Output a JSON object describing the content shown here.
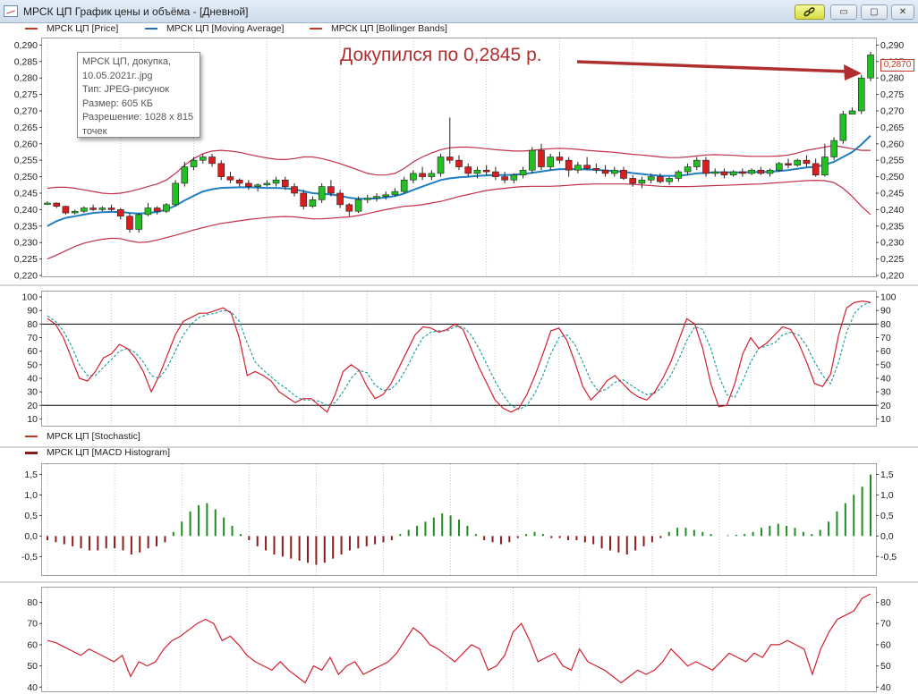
{
  "window": {
    "title": "МРСК ЦП График цены и объёма - [Дневной]",
    "buttons": {
      "min": "▭",
      "max": "▢",
      "close": "✕"
    }
  },
  "legend_main": [
    {
      "label": "МРСК ЦП [Price]",
      "color": "#c0392b"
    },
    {
      "label": "МРСК ЦП [Moving Average]",
      "color": "#1f6fb4"
    },
    {
      "label": "МРСК ЦП [Bollinger Bands]",
      "color": "#c0392b"
    }
  ],
  "legend_lower": [
    {
      "label": "МРСК ЦП [Stochastic]",
      "color": "#c0392b"
    },
    {
      "label": "МРСК ЦП [MACD Histogram]",
      "color": "#8b1a1a"
    }
  ],
  "tooltip": {
    "lines": [
      "МРСК ЦП, докупка,",
      "10.05.2021г..jpg",
      "Тип: JPEG-рисунок",
      "Размер: 605 КБ",
      "Разрешение: 1028 x 815",
      "точек"
    ]
  },
  "annotation": {
    "text": "Докупился по 0,2845 р.",
    "color": "#b03030"
  },
  "last_price_label": "0,2870",
  "colors": {
    "up": "#22c022",
    "down": "#d81e1e",
    "ma": "#1f7fc0",
    "bands": "#c0304a",
    "stoch": "#d02030",
    "signal": "#2aa0a0",
    "macd_pos": "#1e8c1e",
    "macd_neg": "#8b1a1a",
    "grid": "#c8c8c8"
  },
  "chart_data": [
    {
      "type": "candlestick",
      "name": "price",
      "ylim": [
        0.22,
        0.292
      ],
      "yticks": [
        "0,220",
        "0,225",
        "0,230",
        "0,235",
        "0,240",
        "0,245",
        "0,250",
        "0,255",
        "0,260",
        "0,265",
        "0,270",
        "0,275",
        "0,280",
        "0,285",
        "0,290"
      ],
      "candles": [
        [
          0.242,
          0.2425,
          0.2415,
          0.242
        ],
        [
          0.242,
          0.2422,
          0.2405,
          0.241
        ],
        [
          0.241,
          0.2412,
          0.2385,
          0.239
        ],
        [
          0.239,
          0.24,
          0.2385,
          0.2395
        ],
        [
          0.2395,
          0.241,
          0.239,
          0.2405
        ],
        [
          0.2405,
          0.2415,
          0.2395,
          0.24
        ],
        [
          0.24,
          0.241,
          0.2395,
          0.2405
        ],
        [
          0.2405,
          0.2415,
          0.2395,
          0.24
        ],
        [
          0.24,
          0.2405,
          0.237,
          0.238
        ],
        [
          0.238,
          0.239,
          0.233,
          0.234
        ],
        [
          0.234,
          0.239,
          0.233,
          0.2385
        ],
        [
          0.2385,
          0.242,
          0.238,
          0.2405
        ],
        [
          0.2405,
          0.241,
          0.2385,
          0.2395
        ],
        [
          0.2395,
          0.242,
          0.239,
          0.2415
        ],
        [
          0.2415,
          0.249,
          0.241,
          0.248
        ],
        [
          0.248,
          0.2545,
          0.247,
          0.253
        ],
        [
          0.253,
          0.256,
          0.252,
          0.255
        ],
        [
          0.255,
          0.257,
          0.254,
          0.256
        ],
        [
          0.256,
          0.257,
          0.253,
          0.254
        ],
        [
          0.254,
          0.255,
          0.249,
          0.25
        ],
        [
          0.25,
          0.2515,
          0.248,
          0.249
        ],
        [
          0.249,
          0.2495,
          0.247,
          0.248
        ],
        [
          0.248,
          0.249,
          0.246,
          0.247
        ],
        [
          0.247,
          0.248,
          0.2455,
          0.2475
        ],
        [
          0.2475,
          0.249,
          0.247,
          0.248
        ],
        [
          0.248,
          0.25,
          0.247,
          0.249
        ],
        [
          0.249,
          0.25,
          0.246,
          0.247
        ],
        [
          0.247,
          0.248,
          0.244,
          0.245
        ],
        [
          0.245,
          0.246,
          0.24,
          0.241
        ],
        [
          0.241,
          0.244,
          0.2405,
          0.243
        ],
        [
          0.243,
          0.248,
          0.242,
          0.247
        ],
        [
          0.247,
          0.249,
          0.244,
          0.245
        ],
        [
          0.245,
          0.246,
          0.2405,
          0.2415
        ],
        [
          0.2415,
          0.242,
          0.238,
          0.2395
        ],
        [
          0.2395,
          0.244,
          0.239,
          0.243
        ],
        [
          0.243,
          0.2445,
          0.242,
          0.2435
        ],
        [
          0.2435,
          0.245,
          0.2425,
          0.244
        ],
        [
          0.244,
          0.2455,
          0.243,
          0.2445
        ],
        [
          0.2445,
          0.2465,
          0.244,
          0.2455
        ],
        [
          0.2455,
          0.25,
          0.245,
          0.249
        ],
        [
          0.249,
          0.252,
          0.248,
          0.251
        ],
        [
          0.251,
          0.253,
          0.249,
          0.25
        ],
        [
          0.25,
          0.252,
          0.249,
          0.251
        ],
        [
          0.251,
          0.257,
          0.25,
          0.256
        ],
        [
          0.256,
          0.268,
          0.254,
          0.255
        ],
        [
          0.255,
          0.2565,
          0.252,
          0.253
        ],
        [
          0.253,
          0.254,
          0.25,
          0.251
        ],
        [
          0.251,
          0.253,
          0.2495,
          0.252
        ],
        [
          0.252,
          0.2535,
          0.2505,
          0.2515
        ],
        [
          0.2515,
          0.253,
          0.249,
          0.25
        ],
        [
          0.25,
          0.2515,
          0.248,
          0.249
        ],
        [
          0.249,
          0.251,
          0.248,
          0.2505
        ],
        [
          0.2505,
          0.253,
          0.2495,
          0.252
        ],
        [
          0.252,
          0.259,
          0.251,
          0.258
        ],
        [
          0.258,
          0.26,
          0.252,
          0.253
        ],
        [
          0.253,
          0.257,
          0.252,
          0.256
        ],
        [
          0.256,
          0.2575,
          0.254,
          0.255
        ],
        [
          0.255,
          0.256,
          0.25,
          0.252
        ],
        [
          0.252,
          0.2545,
          0.251,
          0.2535
        ],
        [
          0.2535,
          0.256,
          0.252,
          0.2525
        ],
        [
          0.2525,
          0.254,
          0.251,
          0.252
        ],
        [
          0.252,
          0.2535,
          0.25,
          0.251
        ],
        [
          0.251,
          0.253,
          0.25,
          0.252
        ],
        [
          0.252,
          0.253,
          0.249,
          0.2495
        ],
        [
          0.2495,
          0.2505,
          0.247,
          0.248
        ],
        [
          0.248,
          0.25,
          0.2465,
          0.249
        ],
        [
          0.249,
          0.251,
          0.248,
          0.25
        ],
        [
          0.25,
          0.251,
          0.248,
          0.2485
        ],
        [
          0.2485,
          0.25,
          0.2475,
          0.2495
        ],
        [
          0.2495,
          0.252,
          0.2485,
          0.2515
        ],
        [
          0.2515,
          0.254,
          0.2505,
          0.253
        ],
        [
          0.253,
          0.256,
          0.252,
          0.255
        ],
        [
          0.255,
          0.256,
          0.25,
          0.251
        ],
        [
          0.251,
          0.2525,
          0.25,
          0.2515
        ],
        [
          0.2515,
          0.2525,
          0.2495,
          0.2505
        ],
        [
          0.2505,
          0.252,
          0.25,
          0.2515
        ],
        [
          0.2515,
          0.2525,
          0.25,
          0.251
        ],
        [
          0.251,
          0.2525,
          0.2505,
          0.252
        ],
        [
          0.252,
          0.253,
          0.2505,
          0.251
        ],
        [
          0.251,
          0.2525,
          0.25,
          0.252
        ],
        [
          0.252,
          0.2545,
          0.2515,
          0.254
        ],
        [
          0.254,
          0.2555,
          0.2525,
          0.2535
        ],
        [
          0.2535,
          0.2555,
          0.253,
          0.255
        ],
        [
          0.255,
          0.2565,
          0.253,
          0.254
        ],
        [
          0.254,
          0.2555,
          0.25,
          0.2505
        ],
        [
          0.2505,
          0.26,
          0.25,
          0.256
        ],
        [
          0.256,
          0.262,
          0.255,
          0.261
        ],
        [
          0.261,
          0.27,
          0.26,
          0.269
        ],
        [
          0.269,
          0.271,
          0.269,
          0.27
        ],
        [
          0.27,
          0.281,
          0.269,
          0.28
        ],
        [
          0.28,
          0.288,
          0.279,
          0.287
        ]
      ],
      "ma": [
        0.235,
        0.2365,
        0.2375,
        0.238,
        0.2385,
        0.239,
        0.2392,
        0.2393,
        0.2393,
        0.239,
        0.2388,
        0.239,
        0.2393,
        0.24,
        0.2412,
        0.2428,
        0.2442,
        0.2455,
        0.2462,
        0.2466,
        0.2467,
        0.2468,
        0.2468,
        0.2467,
        0.2466,
        0.2466,
        0.2465,
        0.2462,
        0.2456,
        0.245,
        0.2448,
        0.2446,
        0.2442,
        0.2436,
        0.2433,
        0.2433,
        0.2434,
        0.2437,
        0.2441,
        0.2449,
        0.246,
        0.247,
        0.248,
        0.249,
        0.2495,
        0.2498,
        0.25,
        0.2502,
        0.2504,
        0.2505,
        0.2505,
        0.2506,
        0.2508,
        0.2512,
        0.2516,
        0.252,
        0.2523,
        0.2523,
        0.2523,
        0.2522,
        0.2521,
        0.2519,
        0.2517,
        0.2515,
        0.2511,
        0.2508,
        0.2505,
        0.2503,
        0.2502,
        0.2503,
        0.2506,
        0.251,
        0.2512,
        0.2513,
        0.2513,
        0.2513,
        0.2513,
        0.2514,
        0.2514,
        0.2515,
        0.2517,
        0.252,
        0.2524,
        0.2528,
        0.253,
        0.2536,
        0.2545,
        0.256,
        0.2575,
        0.2598,
        0.2625
      ],
      "band_upper": [
        0.2465,
        0.2468,
        0.2468,
        0.2465,
        0.246,
        0.2455,
        0.245,
        0.2448,
        0.245,
        0.2455,
        0.2462,
        0.247,
        0.2478,
        0.249,
        0.251,
        0.2535,
        0.2555,
        0.257,
        0.2578,
        0.258,
        0.2578,
        0.2574,
        0.2568,
        0.2562,
        0.2557,
        0.2553,
        0.2552,
        0.2555,
        0.256,
        0.256,
        0.2555,
        0.2548,
        0.254,
        0.253,
        0.252,
        0.251,
        0.2505,
        0.2505,
        0.251,
        0.2525,
        0.2545,
        0.256,
        0.2572,
        0.2582,
        0.2588,
        0.259,
        0.259,
        0.2588,
        0.2585,
        0.2582,
        0.258,
        0.2578,
        0.2578,
        0.258,
        0.2583,
        0.2585,
        0.2586,
        0.2585,
        0.2583,
        0.258,
        0.2578,
        0.2576,
        0.2574,
        0.2571,
        0.2568,
        0.2566,
        0.2563,
        0.256,
        0.2558,
        0.2558,
        0.256,
        0.2563,
        0.2566,
        0.2567,
        0.2566,
        0.2565,
        0.2563,
        0.2562,
        0.2562,
        0.2562,
        0.2563,
        0.2566,
        0.2572,
        0.258,
        0.2585,
        0.259,
        0.2595,
        0.259,
        0.2585,
        0.258,
        0.258
      ],
      "band_lower": [
        0.225,
        0.2262,
        0.2275,
        0.2288,
        0.2298,
        0.2305,
        0.231,
        0.2313,
        0.2312,
        0.2305,
        0.23,
        0.2302,
        0.2308,
        0.2315,
        0.2322,
        0.233,
        0.2338,
        0.2345,
        0.2352,
        0.2358,
        0.2362,
        0.2366,
        0.237,
        0.2373,
        0.2376,
        0.2378,
        0.2379,
        0.2378,
        0.2375,
        0.2372,
        0.2372,
        0.2374,
        0.2376,
        0.2378,
        0.2382,
        0.2388,
        0.2394,
        0.24,
        0.2405,
        0.241,
        0.2412,
        0.2415,
        0.242,
        0.2425,
        0.2432,
        0.244,
        0.2446,
        0.2452,
        0.2458,
        0.2462,
        0.2465,
        0.2468,
        0.247,
        0.2471,
        0.2471,
        0.2471,
        0.2472,
        0.2474,
        0.2476,
        0.2477,
        0.2478,
        0.2478,
        0.2478,
        0.2478,
        0.2477,
        0.2475,
        0.2473,
        0.2471,
        0.247,
        0.247,
        0.247,
        0.2471,
        0.2472,
        0.2473,
        0.2474,
        0.2475,
        0.2476,
        0.2477,
        0.2478,
        0.248,
        0.2482,
        0.2484,
        0.2486,
        0.2488,
        0.2489,
        0.2488,
        0.2482,
        0.2465,
        0.244,
        0.241,
        0.2385
      ]
    },
    {
      "type": "line",
      "name": "stochastic",
      "ylim": [
        5,
        104
      ],
      "yticks": [
        10,
        20,
        30,
        40,
        50,
        60,
        70,
        80,
        90,
        100
      ],
      "hlines": [
        20,
        80
      ],
      "k": [
        84,
        80,
        70,
        55,
        40,
        38,
        45,
        55,
        58,
        65,
        62,
        55,
        45,
        30,
        42,
        57,
        72,
        82,
        85,
        88,
        88,
        90,
        92,
        88,
        70,
        42,
        45,
        42,
        38,
        30,
        26,
        22,
        25,
        25,
        20,
        15,
        28,
        45,
        50,
        46,
        34,
        25,
        28,
        36,
        48,
        60,
        72,
        78,
        77,
        74,
        76,
        80,
        76,
        62,
        48,
        36,
        24,
        18,
        15,
        18,
        28,
        42,
        58,
        75,
        77,
        68,
        52,
        34,
        24,
        30,
        38,
        42,
        36,
        30,
        26,
        24,
        30,
        40,
        52,
        68,
        84,
        80,
        62,
        36,
        19,
        20,
        36,
        58,
        70,
        62,
        66,
        72,
        78,
        76,
        66,
        52,
        36,
        34,
        43,
        72,
        92,
        96,
        97,
        96
      ],
      "d": [
        86,
        82,
        75,
        64,
        50,
        42,
        42,
        48,
        54,
        60,
        62,
        59,
        52,
        42,
        40,
        48,
        60,
        72,
        80,
        85,
        87,
        88,
        90,
        89,
        82,
        66,
        52,
        46,
        41,
        36,
        32,
        27,
        24,
        24,
        23,
        20,
        22,
        30,
        40,
        46,
        44,
        35,
        31,
        32,
        38,
        48,
        60,
        70,
        74,
        75,
        75,
        78,
        78,
        72,
        62,
        50,
        38,
        28,
        20,
        17,
        20,
        29,
        42,
        58,
        70,
        72,
        65,
        52,
        38,
        30,
        32,
        37,
        39,
        35,
        31,
        28,
        29,
        34,
        42,
        54,
        68,
        78,
        76,
        62,
        42,
        28,
        26,
        38,
        52,
        62,
        64,
        66,
        72,
        74,
        72,
        64,
        52,
        42,
        36,
        52,
        74,
        88,
        94,
        96
      ]
    },
    {
      "type": "bar",
      "name": "macd_histogram",
      "ylim": [
        -0.95,
        1.75
      ],
      "yticks": [
        "-0,5",
        "0,0",
        "0,5",
        "1,0",
        "1,5"
      ],
      "values": [
        -0.1,
        -0.15,
        -0.2,
        -0.25,
        -0.3,
        -0.35,
        -0.35,
        -0.3,
        -0.3,
        -0.35,
        -0.45,
        -0.4,
        -0.3,
        -0.25,
        -0.15,
        0.1,
        0.35,
        0.6,
        0.75,
        0.8,
        0.65,
        0.45,
        0.25,
        0.05,
        -0.1,
        -0.25,
        -0.35,
        -0.45,
        -0.5,
        -0.55,
        -0.6,
        -0.65,
        -0.7,
        -0.65,
        -0.55,
        -0.45,
        -0.35,
        -0.3,
        -0.25,
        -0.2,
        -0.15,
        -0.1,
        0.05,
        0.15,
        0.25,
        0.35,
        0.45,
        0.55,
        0.5,
        0.4,
        0.25,
        0.05,
        -0.1,
        -0.15,
        -0.2,
        -0.15,
        -0.05,
        0.05,
        0.1,
        0.05,
        -0.05,
        -0.05,
        -0.1,
        -0.1,
        -0.15,
        -0.2,
        -0.3,
        -0.35,
        -0.4,
        -0.45,
        -0.35,
        -0.25,
        -0.15,
        -0.05,
        0.1,
        0.2,
        0.2,
        0.15,
        0.1,
        0.05,
        0.0,
        0.02,
        0.03,
        0.05,
        0.1,
        0.2,
        0.25,
        0.3,
        0.25,
        0.2,
        0.1,
        0.05,
        0.15,
        0.35,
        0.6,
        0.8,
        1.0,
        1.2,
        1.5
      ]
    },
    {
      "type": "line",
      "name": "oscillator",
      "ylim": [
        38,
        87
      ],
      "yticks": [
        40,
        50,
        60,
        70,
        80
      ],
      "values": [
        62,
        61,
        59,
        57,
        55,
        58,
        56,
        54,
        52,
        55,
        45,
        52,
        50,
        52,
        58,
        62,
        64,
        67,
        70,
        72,
        70,
        62,
        64,
        60,
        55,
        52,
        50,
        48,
        52,
        48,
        45,
        42,
        50,
        48,
        54,
        46,
        50,
        52,
        46,
        48,
        50,
        52,
        56,
        62,
        68,
        65,
        60,
        58,
        55,
        52,
        56,
        60,
        58,
        48,
        50,
        55,
        66,
        70,
        62,
        52,
        54,
        56,
        50,
        48,
        58,
        52,
        50,
        48,
        45,
        42,
        45,
        48,
        46,
        48,
        52,
        58,
        54,
        50,
        52,
        50,
        48,
        52,
        56,
        54,
        52,
        56,
        54,
        60,
        60,
        62,
        60,
        58,
        46,
        58,
        66,
        72,
        74,
        76,
        82,
        84
      ]
    }
  ]
}
